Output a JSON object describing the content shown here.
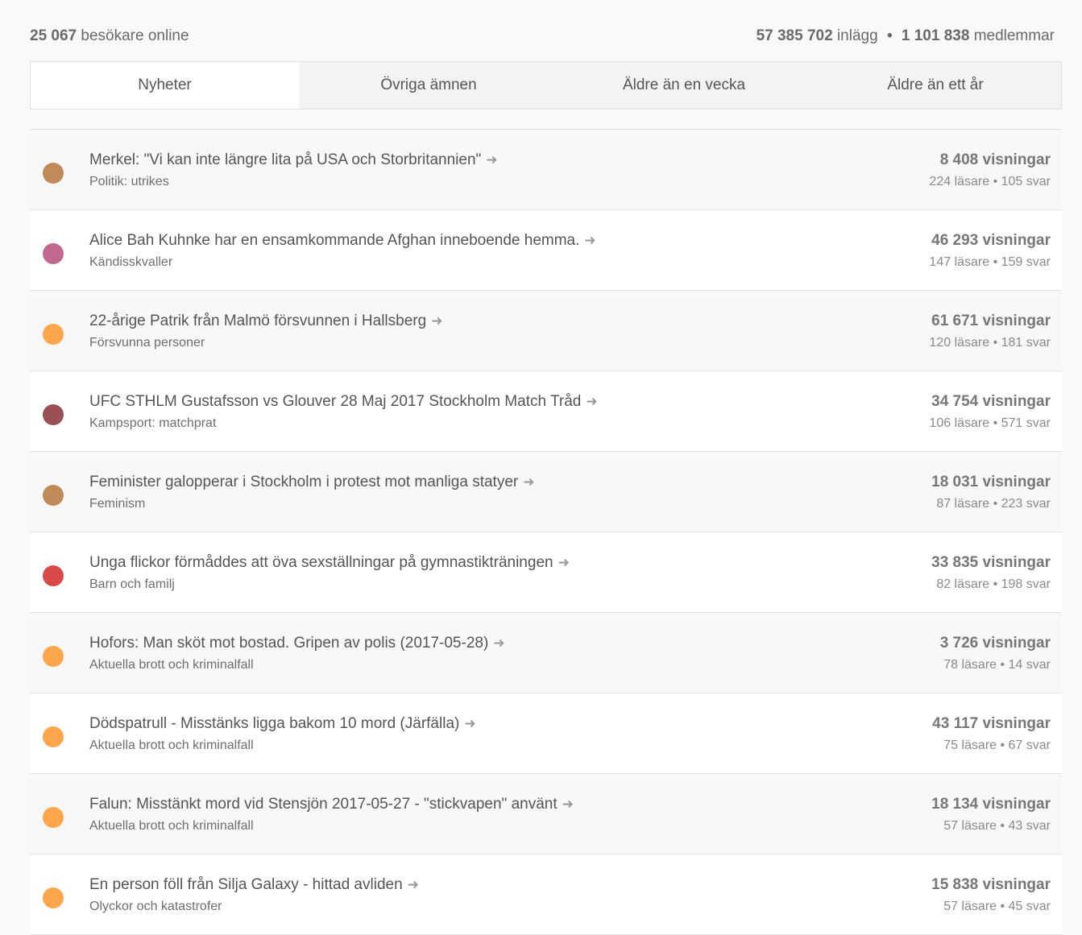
{
  "stats": {
    "visitors_count": "25 067",
    "visitors_label": "besökare online",
    "posts_count": "57 385 702",
    "posts_label": "inlägg",
    "separator": "•",
    "members_count": "1 101 838",
    "members_label": "medlemmar"
  },
  "tabs": [
    {
      "label": "Nyheter",
      "active": true
    },
    {
      "label": "Övriga ämnen",
      "active": false
    },
    {
      "label": "Äldre än en vecka",
      "active": false
    },
    {
      "label": "Äldre än ett år",
      "active": false
    }
  ],
  "arrow_glyph": "➜",
  "threads": [
    {
      "title": "Merkel: \"Vi kan inte längre lita på USA och Storbritannien\"",
      "category": "Politik: utrikes",
      "views": "8 408 visningar",
      "meta": "224 läsare • 105 svar",
      "color": "#c08a5a"
    },
    {
      "title": "Alice Bah Kuhnke har en ensamkommande Afghan inneboende hemma.",
      "category": "Kändisskvaller",
      "views": "46 293 visningar",
      "meta": "147 läsare • 159 svar",
      "color": "#c06890"
    },
    {
      "title": "22-årige Patrik från Malmö försvunnen i Hallsberg",
      "category": "Försvunna personer",
      "views": "61 671 visningar",
      "meta": "120 läsare • 181 svar",
      "color": "#ffa64d"
    },
    {
      "title": "UFC STHLM Gustafsson vs Glouver 28 Maj 2017 Stockholm Match Tråd",
      "category": "Kampsport: matchprat",
      "views": "34 754 visningar",
      "meta": "106 läsare • 571 svar",
      "color": "#9a5055"
    },
    {
      "title": "Feminister galopperar i Stockholm i protest mot manliga statyer",
      "category": "Feminism",
      "views": "18 031 visningar",
      "meta": "87 läsare • 223 svar",
      "color": "#c08a5a"
    },
    {
      "title": "Unga flickor förmåddes att öva sexställningar på gymnastikträningen",
      "category": "Barn och familj",
      "views": "33 835 visningar",
      "meta": "82 läsare • 198 svar",
      "color": "#d84a4a"
    },
    {
      "title": "Hofors: Man sköt mot bostad. Gripen av polis (2017-05-28)",
      "category": "Aktuella brott och kriminalfall",
      "views": "3 726 visningar",
      "meta": "78 läsare • 14 svar",
      "color": "#ffa64d"
    },
    {
      "title": "Dödspatrull - Misstänks ligga bakom 10 mord (Järfälla)",
      "category": "Aktuella brott och kriminalfall",
      "views": "43 117 visningar",
      "meta": "75 läsare • 67 svar",
      "color": "#ffa64d"
    },
    {
      "title": "Falun: Misstänkt mord vid Stensjön 2017-05-27 - \"stickvapen\" använt",
      "category": "Aktuella brott och kriminalfall",
      "views": "18 134 visningar",
      "meta": "57 läsare • 43 svar",
      "color": "#ffa64d"
    },
    {
      "title": "En person föll från Silja Galaxy - hittad avliden",
      "category": "Olyckor och katastrofer",
      "views": "15 838 visningar",
      "meta": "57 läsare • 45 svar",
      "color": "#ffa64d"
    }
  ]
}
